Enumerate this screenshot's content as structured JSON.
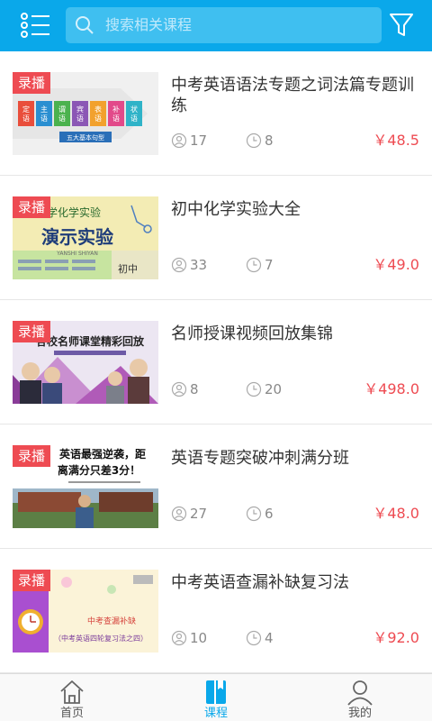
{
  "header": {
    "menu_icon": "list-menu-icon",
    "search_placeholder": "搜索相关课程",
    "filter_icon": "funnel-filter-icon",
    "colors": {
      "bar": "#0aa8ea",
      "search_bg": "#3fbff0"
    }
  },
  "courses": [
    {
      "tag": "录播",
      "title": "中考英语语法专题之词法篇专题训练",
      "students": "17",
      "lessons": "8",
      "price": "￥48.5",
      "thumb_text": [
        "定",
        "主",
        "谓",
        "宾",
        "表",
        "补",
        "状",
        "语",
        "语",
        "语",
        "语",
        "语",
        "语",
        "语",
        "五大基本句型"
      ]
    },
    {
      "tag": "录播",
      "title": "初中化学实验大全",
      "students": "33",
      "lessons": "7",
      "price": "￥49.0",
      "thumb_text": [
        "中学化学实验",
        "演示实验",
        "YANSHI SHIYAN",
        "初中"
      ]
    },
    {
      "tag": "录播",
      "title": "名师授课视频回放集锦",
      "students": "8",
      "lessons": "20",
      "price": "￥498.0",
      "thumb_text": [
        "各校名师课堂精彩回放"
      ]
    },
    {
      "tag": "录播",
      "title": "英语专题突破冲刺满分班",
      "students": "27",
      "lessons": "6",
      "price": "￥48.0",
      "thumb_text": [
        "英语最强逆袭，距",
        "离满分只差3分！"
      ]
    },
    {
      "tag": "录播",
      "title": "中考英语查漏补缺复习法",
      "students": "10",
      "lessons": "4",
      "price": "￥92.0",
      "thumb_text": [
        "中考查漏补缺",
        "（中考英语四轮复习法之四）"
      ]
    }
  ],
  "icons": {
    "students": "person-icon",
    "lessons": "clock-icon"
  },
  "tabs": [
    {
      "label": "首页",
      "icon": "home-icon",
      "active": false
    },
    {
      "label": "课程",
      "icon": "book-icon",
      "active": true
    },
    {
      "label": "我的",
      "icon": "user-icon",
      "active": false
    }
  ],
  "colors": {
    "price": "#ee4b52",
    "tag": "#ee4b52",
    "active_tab": "#0aa8ea"
  }
}
